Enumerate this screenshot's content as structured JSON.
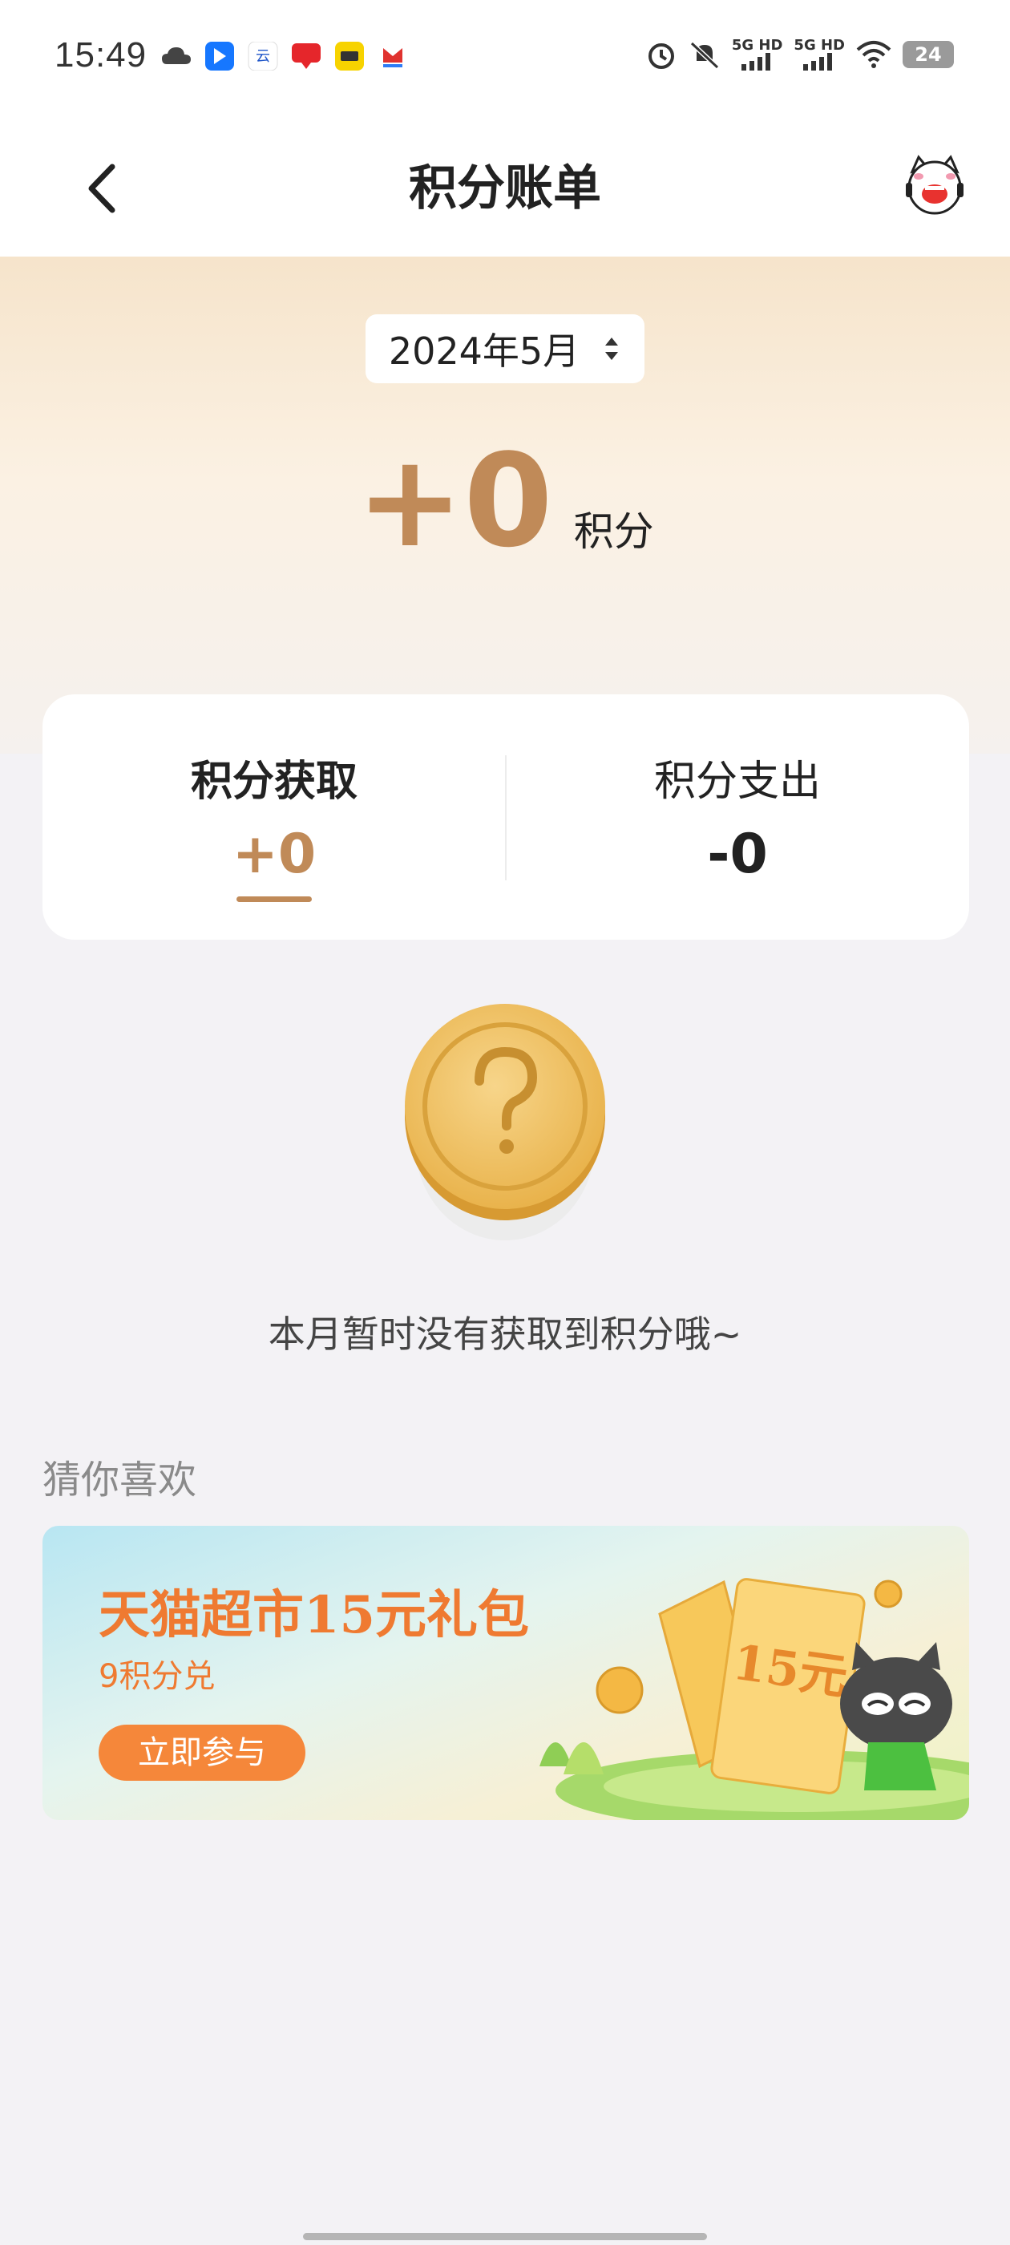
{
  "status_bar": {
    "time": "15:49",
    "signal_1": "5G HD",
    "signal_2": "5G HD",
    "battery": "24",
    "icons": [
      "cloud-icon",
      "app-icon-blue",
      "app-icon-yun",
      "app-icon-unionpay",
      "app-icon-yellow",
      "app-icon-red",
      "alarm-icon",
      "mute-icon",
      "signal-icon",
      "wifi-icon",
      "battery-icon"
    ]
  },
  "nav": {
    "title": "积分账单"
  },
  "header": {
    "month": "2024年5月",
    "total_value": "+0",
    "total_unit": "积分"
  },
  "summary": {
    "earn_label": "积分获取",
    "earn_value": "+0",
    "spend_label": "积分支出",
    "spend_value": "-0",
    "active_tab": "earn"
  },
  "empty_state": {
    "message": "本月暂时没有获取到积分哦~"
  },
  "recommend": {
    "title": "猜你喜欢",
    "promo": {
      "title": "天猫超市15元礼包",
      "subtitle": "9积分兑",
      "button": "立即参与",
      "coupon_text": "15元"
    }
  },
  "colors": {
    "accent": "#c08a58",
    "promo_orange": "#ef7a31",
    "background": "#f3f2f5"
  }
}
